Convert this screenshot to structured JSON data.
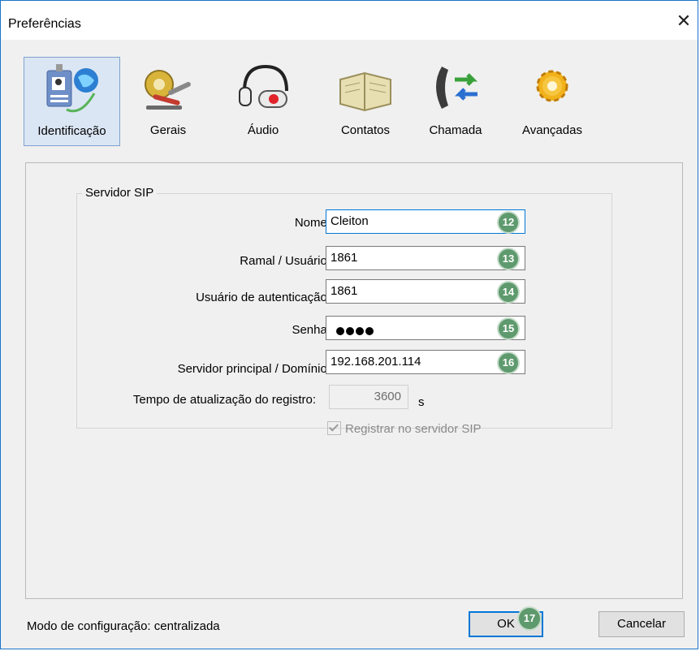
{
  "window": {
    "title": "Preferências",
    "close_label": "✕"
  },
  "toolbar": {
    "items": [
      {
        "label": "Identificação",
        "icon": "id-badge-globe-icon",
        "active": true
      },
      {
        "label": "Gerais",
        "icon": "tools-gear-icon"
      },
      {
        "label": "Áudio",
        "icon": "headset-icon"
      },
      {
        "label": "Contatos",
        "icon": "address-book-icon"
      },
      {
        "label": "Chamada",
        "icon": "phone-transfer-icon"
      },
      {
        "label": "Avançadas",
        "icon": "gears-icon"
      }
    ]
  },
  "sip": {
    "group_label": "Servidor SIP",
    "name_label": "Nome:",
    "name_value": "Cleiton",
    "ramal_label": "Ramal / Usuário:",
    "ramal_value": "1861",
    "auth_label": "Usuário de autenticação:",
    "auth_value": "1861",
    "senha_label": "Senha:",
    "server_label": "Servidor principal / Domínio:",
    "server_value": "192.168.201.114",
    "update_label": "Tempo de atualização do registro:",
    "update_value": "3600",
    "update_unit": "s",
    "register_label": "Registrar no servidor SIP",
    "register_checked": true
  },
  "badges": {
    "name": "12",
    "ramal": "13",
    "auth": "14",
    "senha": "15",
    "server": "16",
    "ok": "17"
  },
  "footer": {
    "mode_text": "Modo de configuração: centralizada",
    "ok_label": "OK",
    "cancel_label": "Cancelar"
  },
  "colors": {
    "accent": "#0078d7",
    "badge": "#5e9a6d",
    "active_tab": "#dbe6f4"
  }
}
